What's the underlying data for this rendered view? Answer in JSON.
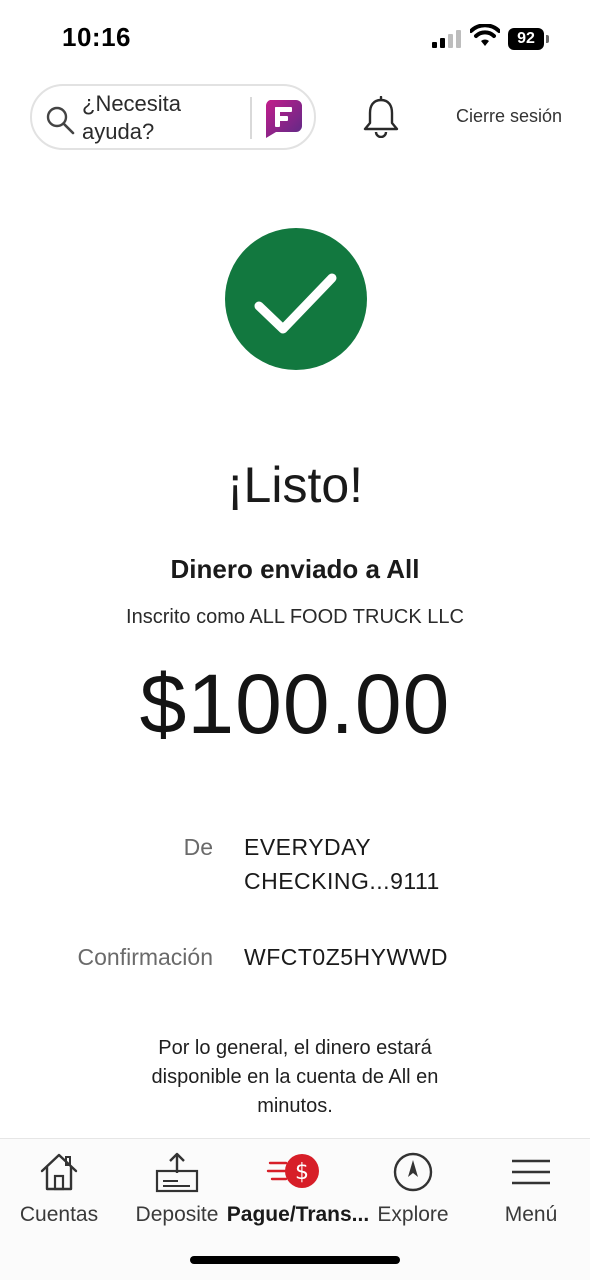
{
  "status_bar": {
    "time": "10:16",
    "battery": "92",
    "signal_icon": "cellular-signal-icon",
    "wifi_icon": "wifi-icon"
  },
  "header": {
    "search_text": "¿Necesita ayuda?",
    "search_icon": "search-icon",
    "assistant_icon": "fargo-assistant-logo",
    "notifications_icon": "bell-icon",
    "logout_label": "Cierre sesión"
  },
  "confirmation": {
    "success_icon": "checkmark-circle-icon",
    "success_color": "#12783f",
    "title": "¡Listo!",
    "subtitle": "Dinero enviado a All",
    "enrolled_as": "Inscrito como ALL FOOD TRUCK LLC",
    "amount": "$100.00",
    "details": {
      "from_label": "De",
      "from_value": "EVERYDAY CHECKING...9111",
      "confirmation_label": "Confirmación",
      "confirmation_value": "WFCT0Z5HYWWD"
    },
    "note": "Por lo general, el dinero estará disponible en la cuenta de All en minutos."
  },
  "bottom_nav": {
    "accent_color": "#d71e28",
    "items": [
      {
        "label": "Cuentas",
        "icon": "home-icon"
      },
      {
        "label": "Deposite",
        "icon": "deposit-icon"
      },
      {
        "label": "Pague/Trans...",
        "icon": "pay-transfer-icon",
        "active": true
      },
      {
        "label": "Explore",
        "icon": "compass-icon"
      },
      {
        "label": "Menú",
        "icon": "hamburger-menu-icon"
      }
    ]
  }
}
